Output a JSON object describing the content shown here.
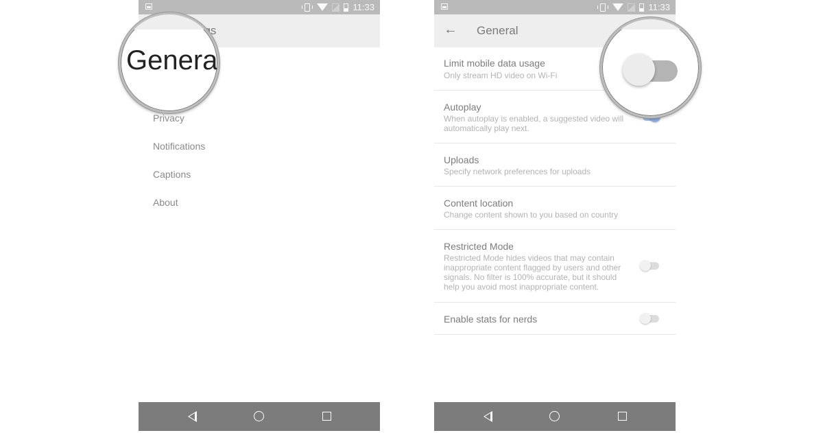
{
  "status_bar": {
    "time": "11:33"
  },
  "left_screen": {
    "toolbar_title_partial": "ngs",
    "magnifier_text": "General",
    "menu_items": [
      "Privacy",
      "Notifications",
      "Captions",
      "About"
    ]
  },
  "right_screen": {
    "toolbar_title": "General",
    "settings": [
      {
        "title": "Limit mobile data usage",
        "description": "Only stream HD video on Wi-Fi",
        "toggle": "off"
      },
      {
        "title": "Autoplay",
        "description": "When autoplay is enabled, a suggested video will automatically play next.",
        "toggle": "on"
      },
      {
        "title": "Uploads",
        "description": "Specify network preferences for uploads"
      },
      {
        "title": "Content location",
        "description": "Change content shown to you based on country"
      },
      {
        "title": "Restricted Mode",
        "description": "Restricted Mode hides videos that may contain inappropriate content flagged by users and other signals. No filter is 100% accurate, but it should help you avoid most inappropriate content.",
        "toggle": "off"
      },
      {
        "title": "Enable stats for nerds",
        "description": "",
        "toggle": "off"
      }
    ]
  },
  "icons": {
    "status": [
      "image-icon",
      "vibrate-icon",
      "wifi-icon",
      "no-signal-icon",
      "battery-charging-icon"
    ],
    "nav": [
      "nav-back-icon",
      "nav-home-icon",
      "nav-recents-icon"
    ],
    "toolbar": [
      "back-arrow-icon"
    ]
  }
}
